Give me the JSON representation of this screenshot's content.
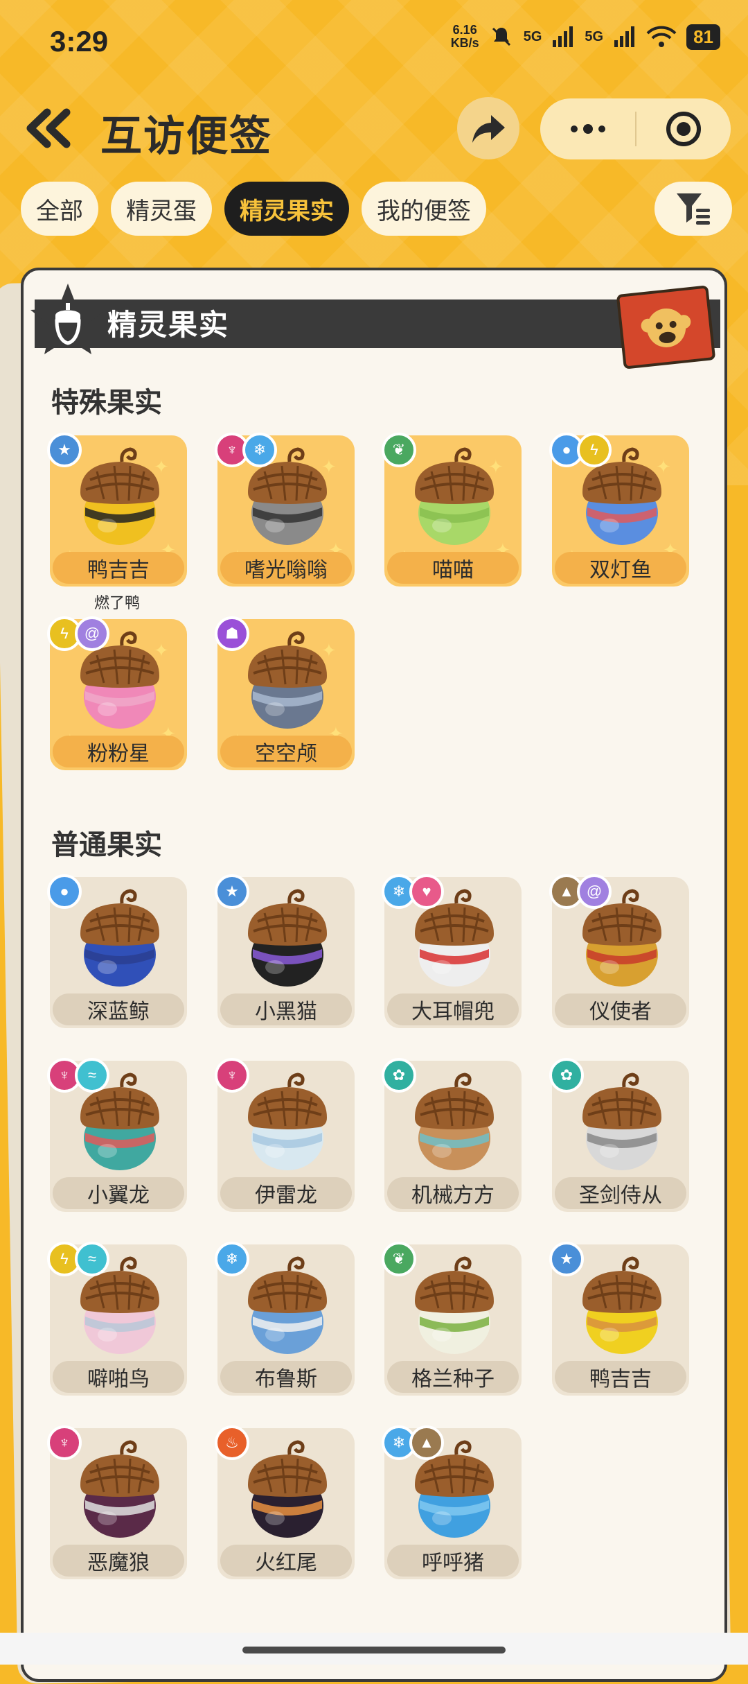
{
  "status": {
    "time": "3:29",
    "speed_top": "6.16",
    "speed_bottom": "KB/s",
    "net1": "5G",
    "net2": "5G",
    "battery": "81"
  },
  "header": {
    "title": "互访便签"
  },
  "tabs": [
    {
      "label": "全部",
      "active": false
    },
    {
      "label": "精灵蛋",
      "active": false
    },
    {
      "label": "精灵果实",
      "active": true
    },
    {
      "label": "我的便签",
      "active": false
    }
  ],
  "banner": {
    "title": "精灵果实"
  },
  "special": {
    "title": "特殊果实",
    "items": [
      {
        "name": "鸭吉吉",
        "sub": "燃了鸭",
        "badges": [
          {
            "icon": "star-icon",
            "color": "#4a8fd8"
          }
        ],
        "body": "#f0c020",
        "band": "#222"
      },
      {
        "name": "嗜光嗡嗡",
        "sub": "",
        "badges": [
          {
            "icon": "demon-icon",
            "color": "#d8407a"
          },
          {
            "icon": "snowflake-icon",
            "color": "#4aa8e8"
          }
        ],
        "body": "#8a8a8a",
        "band": "#333"
      },
      {
        "name": "喵喵",
        "sub": "",
        "badges": [
          {
            "icon": "leaf-icon",
            "color": "#4aa860"
          }
        ],
        "body": "#a8d868",
        "band": "#88c050"
      },
      {
        "name": "双灯鱼",
        "sub": "",
        "badges": [
          {
            "icon": "water-icon",
            "color": "#4a9be8"
          },
          {
            "icon": "lightning-icon",
            "color": "#e8c020"
          }
        ],
        "body": "#5a8ee0",
        "band": "#e05a5a"
      },
      {
        "name": "粉粉星",
        "sub": "",
        "badges": [
          {
            "icon": "lightning-icon",
            "color": "#e8c020"
          },
          {
            "icon": "spiral-icon",
            "color": "#a080e0"
          }
        ],
        "body": "#f088b8",
        "band": "#f0a8c8"
      },
      {
        "name": "空空颅",
        "sub": "",
        "badges": [
          {
            "icon": "ghost-icon",
            "color": "#9a50d8"
          }
        ],
        "body": "#6a7890",
        "band": "#a8b8d0"
      }
    ]
  },
  "normal": {
    "title": "普通果实",
    "items": [
      {
        "name": "深蓝鲸",
        "badges": [
          {
            "icon": "water-icon",
            "color": "#4a9be8"
          }
        ],
        "body": "#3050b8",
        "band": "#2a3e90"
      },
      {
        "name": "小黑猫",
        "badges": [
          {
            "icon": "star-icon",
            "color": "#4a8fd8"
          }
        ],
        "body": "#222",
        "band": "#8a5ad8"
      },
      {
        "name": "大耳帽兜",
        "badges": [
          {
            "icon": "snowflake-icon",
            "color": "#4aa8e8"
          },
          {
            "icon": "heart-icon",
            "color": "#e85a8a"
          }
        ],
        "body": "#eeeeee",
        "band": "#d83030"
      },
      {
        "name": "仪使者",
        "badges": [
          {
            "icon": "mountain-icon",
            "color": "#9a7a50"
          },
          {
            "icon": "spiral-icon",
            "color": "#a080e0"
          }
        ],
        "body": "#d8a030",
        "band": "#c83a2a"
      },
      {
        "name": "小翼龙",
        "badges": [
          {
            "icon": "demon-icon",
            "color": "#d8407a"
          },
          {
            "icon": "wind-icon",
            "color": "#40c0d0"
          }
        ],
        "body": "#40a8a0",
        "band": "#e05a5a"
      },
      {
        "name": "伊雷龙",
        "badges": [
          {
            "icon": "demon-icon",
            "color": "#d8407a"
          }
        ],
        "body": "#d8e8f0",
        "band": "#a8c8e0"
      },
      {
        "name": "机械方方",
        "badges": [
          {
            "icon": "gear-icon",
            "color": "#30b0a0"
          }
        ],
        "body": "#c8905a",
        "band": "#70c0c8"
      },
      {
        "name": "圣剑侍从",
        "badges": [
          {
            "icon": "gear-icon",
            "color": "#30b0a0"
          }
        ],
        "body": "#d8d8d8",
        "band": "#888"
      },
      {
        "name": "噼啪鸟",
        "badges": [
          {
            "icon": "lightning-icon",
            "color": "#e8c020"
          },
          {
            "icon": "wind-icon",
            "color": "#40c0d0"
          }
        ],
        "body": "#f0c8d8",
        "band": "#b8c8d8"
      },
      {
        "name": "布鲁斯",
        "badges": [
          {
            "icon": "snowflake-icon",
            "color": "#4aa8e8"
          }
        ],
        "body": "#6aa0d8",
        "band": "#f0f0f0"
      },
      {
        "name": "格兰种子",
        "badges": [
          {
            "icon": "leaf-icon",
            "color": "#4aa860"
          }
        ],
        "body": "#f0f0e0",
        "band": "#7ab040"
      },
      {
        "name": "鸭吉吉",
        "badges": [
          {
            "icon": "star-icon",
            "color": "#4a8fd8"
          }
        ],
        "body": "#f0d020",
        "band": "#d89040"
      },
      {
        "name": "恶魔狼",
        "badges": [
          {
            "icon": "demon-icon",
            "color": "#d8407a"
          }
        ],
        "body": "#5a2a48",
        "band": "#e0e0e0"
      },
      {
        "name": "火红尾",
        "badges": [
          {
            "icon": "fire-icon",
            "color": "#e8602a"
          }
        ],
        "body": "#2a2030",
        "band": "#e89040"
      },
      {
        "name": "呼呼猪",
        "badges": [
          {
            "icon": "snowflake-icon",
            "color": "#4aa8e8"
          },
          {
            "icon": "mountain-icon",
            "color": "#9a7a50"
          }
        ],
        "body": "#40a0e0",
        "band": "#80c8f0"
      }
    ]
  }
}
